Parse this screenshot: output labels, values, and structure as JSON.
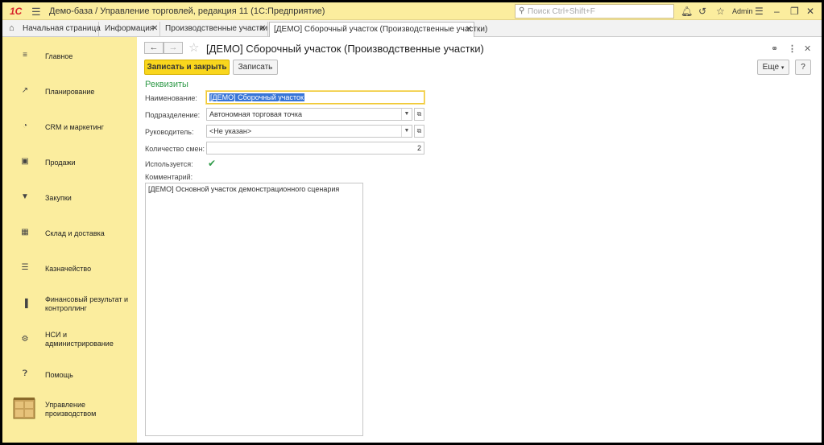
{
  "app": {
    "title": "Демо-база / Управление торговлей, редакция 11  (1С:Предприятие)",
    "logo": "1С",
    "search_placeholder": "Поиск Ctrl+Shift+F",
    "user": "Admin"
  },
  "tabs": [
    {
      "label": "Начальная страница"
    },
    {
      "label": "Информация"
    },
    {
      "label": "Производственные участки"
    },
    {
      "label": "[ДЕМО] Сборочный участок (Производственные участки)"
    }
  ],
  "sidebar": {
    "items": [
      {
        "label": "Главное",
        "icon": "menu-icon"
      },
      {
        "label": "Планирование",
        "icon": "planning-icon"
      },
      {
        "label": "CRM и маркетинг",
        "icon": "pie-chart-icon"
      },
      {
        "label": "Продажи",
        "icon": "briefcase-icon"
      },
      {
        "label": "Закупки",
        "icon": "cart-icon"
      },
      {
        "label": "Склад и доставка",
        "icon": "warehouse-icon"
      },
      {
        "label": "Казначейство",
        "icon": "coins-icon"
      },
      {
        "label": "Финансовый результат и контроллинг",
        "icon": "bar-chart-icon"
      },
      {
        "label": "НСИ и администрирование",
        "icon": "gear-icon"
      },
      {
        "label": "Помощь",
        "icon": "help-icon"
      },
      {
        "label": "Управление производством",
        "icon": "production-icon"
      }
    ]
  },
  "form": {
    "title": "[ДЕМО] Сборочный участок (Производственные участки)",
    "save_close_label": "Записать и закрыть",
    "save_label": "Записать",
    "more_label": "Еще",
    "help_label": "?",
    "group_title": "Реквизиты",
    "fields": {
      "name_label": "Наименование:",
      "name_value": "[ДЕМО] Сборочный участок",
      "division_label": "Подразделение:",
      "division_value": "Автономная торговая точка",
      "manager_label": "Руководитель:",
      "manager_value": "<Не указан>",
      "shifts_label": "Количество смен:",
      "shifts_value": "2",
      "used_label": "Используется:",
      "used_checked": true,
      "comment_label": "Комментарий:",
      "comment_value": "[ДЕМО] Основной участок демонстрационного сценария"
    }
  },
  "colors": {
    "panel": "#fbed9e",
    "primary_button": "#f9d61d",
    "group_title": "#2f9a48",
    "selection": "#3875d7"
  }
}
